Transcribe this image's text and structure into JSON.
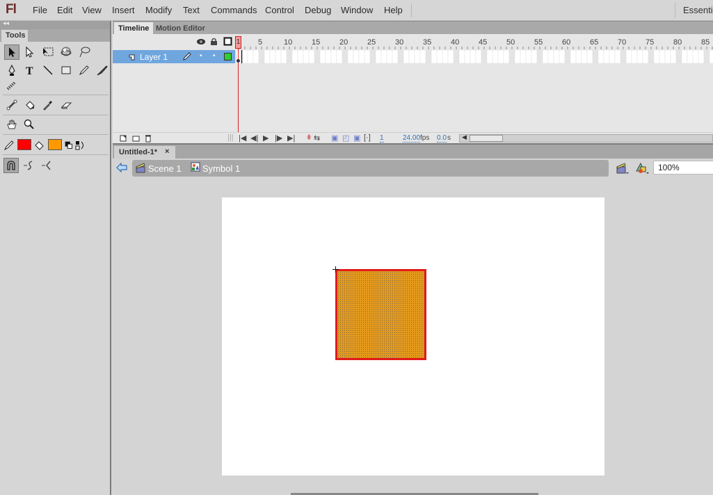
{
  "menubar": {
    "logo": "Fl",
    "items": [
      "File",
      "Edit",
      "View",
      "Insert",
      "Modify",
      "Text",
      "Commands",
      "Control",
      "Debug",
      "Window",
      "Help"
    ],
    "workspace": "Essentia"
  },
  "tools_panel": {
    "collapse_icon": "◂◂",
    "tab_label": "Tools",
    "tools": [
      {
        "name": "selection-tool",
        "selected": true
      },
      {
        "name": "subselection-tool"
      },
      {
        "name": "free-transform-tool"
      },
      {
        "name": "3d-rotation-tool"
      },
      {
        "name": "lasso-tool"
      },
      {
        "name": "pen-tool"
      },
      {
        "name": "text-tool"
      },
      {
        "name": "line-tool"
      },
      {
        "name": "rectangle-tool"
      },
      {
        "name": "pencil-tool"
      },
      {
        "name": "brush-tool"
      },
      {
        "name": "deco-tool"
      },
      {
        "name": "bone-tool"
      },
      {
        "name": "paint-bucket-tool"
      },
      {
        "name": "eyedropper-tool"
      },
      {
        "name": "eraser-tool"
      },
      {
        "name": "hand-tool"
      },
      {
        "name": "zoom-tool"
      }
    ],
    "stroke_color": "#ff0000",
    "fill_color": "#ff9900"
  },
  "timeline": {
    "tabs": [
      "Timeline",
      "Motion Editor"
    ],
    "active_tab": "Timeline",
    "frame_numbers": [
      "1",
      "5",
      "10",
      "15",
      "20",
      "25",
      "30",
      "35",
      "40",
      "45",
      "50",
      "55",
      "60",
      "65",
      "70",
      "75",
      "80",
      "85"
    ],
    "current_frame_marker": "1",
    "layers": [
      {
        "name": "Layer 1",
        "color": "#33cc33"
      }
    ],
    "footer": {
      "current_frame": "1",
      "fps": "24.00",
      "fps_unit": "fps",
      "elapsed": "0.0",
      "elapsed_unit": "s"
    }
  },
  "document": {
    "tab_label": "Untitled-1*",
    "close_label": "×",
    "breadcrumbs": [
      {
        "label": "Scene 1",
        "icon": "scene-icon"
      },
      {
        "label": "Symbol 1",
        "icon": "symbol-icon"
      }
    ],
    "zoom_level": "100%"
  },
  "stage": {
    "background": "#ffffff",
    "shape": {
      "type": "rectangle",
      "fill": "#e69a1c",
      "stroke": "#e31a1a",
      "selected": true
    }
  }
}
